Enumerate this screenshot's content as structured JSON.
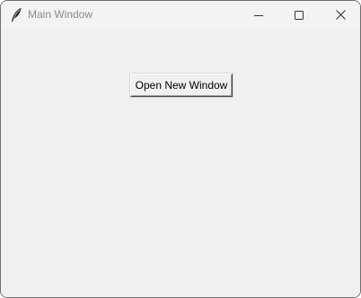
{
  "window": {
    "title": "Main Window",
    "controls": {
      "minimize_icon": "minimize-icon",
      "maximize_icon": "maximize-icon",
      "close_icon": "close-icon"
    },
    "app_icon": "feather-icon"
  },
  "main": {
    "open_button_label": "Open New Window"
  },
  "colors": {
    "titlebar_bg": "#f3f3f3",
    "client_bg": "#f0f0f0",
    "title_text": "#8a8a8a",
    "button_text": "#000000"
  }
}
